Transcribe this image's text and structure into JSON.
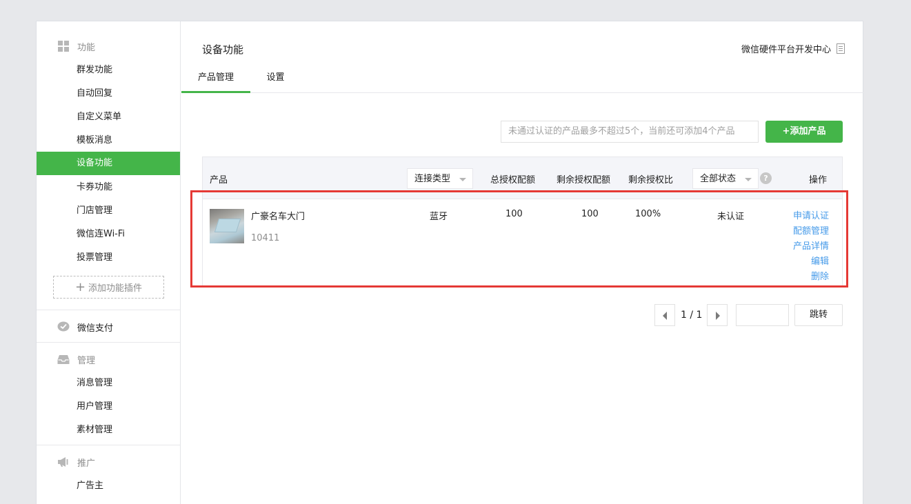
{
  "sidebar": {
    "groups": [
      {
        "title": "功能",
        "icon": "grid-icon",
        "items": [
          "群发功能",
          "自动回复",
          "自定义菜单",
          "模板消息",
          "设备功能",
          "卡券功能",
          "门店管理",
          "微信连Wi-Fi",
          "投票管理"
        ]
      },
      {
        "title": "微信支付",
        "icon": "wechat-pay-icon"
      },
      {
        "title": "管理",
        "icon": "inbox-icon",
        "items": [
          "消息管理",
          "用户管理",
          "素材管理"
        ]
      },
      {
        "title": "推广",
        "icon": "megaphone-icon",
        "items": [
          "广告主"
        ]
      }
    ],
    "active_item": "设备功能",
    "add_plugin": {
      "plus": "+",
      "label": "添加功能插件"
    }
  },
  "header": {
    "title": "设备功能",
    "dev_center_link": "微信硬件平台开发中心",
    "tabs": [
      {
        "label": "产品管理",
        "active": true
      },
      {
        "label": "设置",
        "active": false
      }
    ]
  },
  "toolbar": {
    "hint": "未通过认证的产品最多不超过5个，当前还可添加4个产品",
    "add_button": "+添加产品"
  },
  "table": {
    "columns": {
      "product": "产品",
      "connection_type": "连接类型",
      "total_quota": "总授权配额",
      "remaining_quota": "剩余授权配额",
      "remaining_ratio": "剩余授权比",
      "status_filter": "全部状态",
      "help": "?",
      "actions": "操作"
    },
    "rows": [
      {
        "name": "广豪名车大门",
        "id": "10411",
        "connection_type": "蓝牙",
        "total_quota": "100",
        "remaining_quota": "100",
        "remaining_ratio": "100%",
        "status": "未认证",
        "actions": [
          "申请认证",
          "配额管理",
          "产品详情",
          "编辑",
          "删除"
        ]
      }
    ]
  },
  "pagination": {
    "label": "1 / 1",
    "go_button": "跳转"
  },
  "colors": {
    "accent": "#44b549",
    "link": "#459ae9",
    "highlight_box": "#e53935"
  }
}
